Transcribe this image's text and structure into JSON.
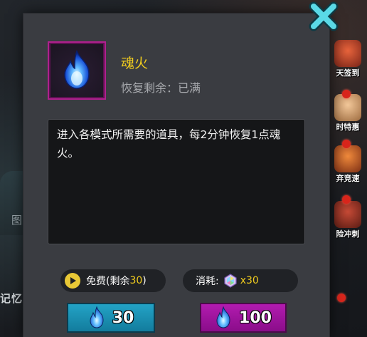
{
  "background": {
    "figure_label": "图",
    "memory_label": "记忆",
    "side_menu": [
      {
        "label": "天签到",
        "color": "#c8452a"
      },
      {
        "label": "时特惠",
        "color": "#e8b07a"
      },
      {
        "label": "弃竞速",
        "color": "#d8663a"
      },
      {
        "label": "险冲刺",
        "color": "#9b3b2c"
      }
    ]
  },
  "dialog": {
    "close_icon": "close-x-icon",
    "item": {
      "icon": "blue-flame-icon",
      "name": "魂火",
      "recover_label": "恢复剩余：",
      "recover_value": "已满"
    },
    "description": "进入各模式所需要的道具，每2分钟恢复1点魂火。",
    "free_info": {
      "icon": "play-video-icon",
      "label": "免费(剩余",
      "count": "30",
      "suffix": ")"
    },
    "cost_info": {
      "label": "消耗:",
      "icon": "rainbow-gem-icon",
      "amount": "x30"
    },
    "buttons": {
      "free_value": "30",
      "paid_value": "100"
    },
    "colors": {
      "title_gold": "#f0cc1e",
      "free_button": "#1b93b8",
      "paid_button": "#a016a0",
      "frame_magenta": "#b0208e",
      "close_cyan": "#56d6e2"
    }
  }
}
